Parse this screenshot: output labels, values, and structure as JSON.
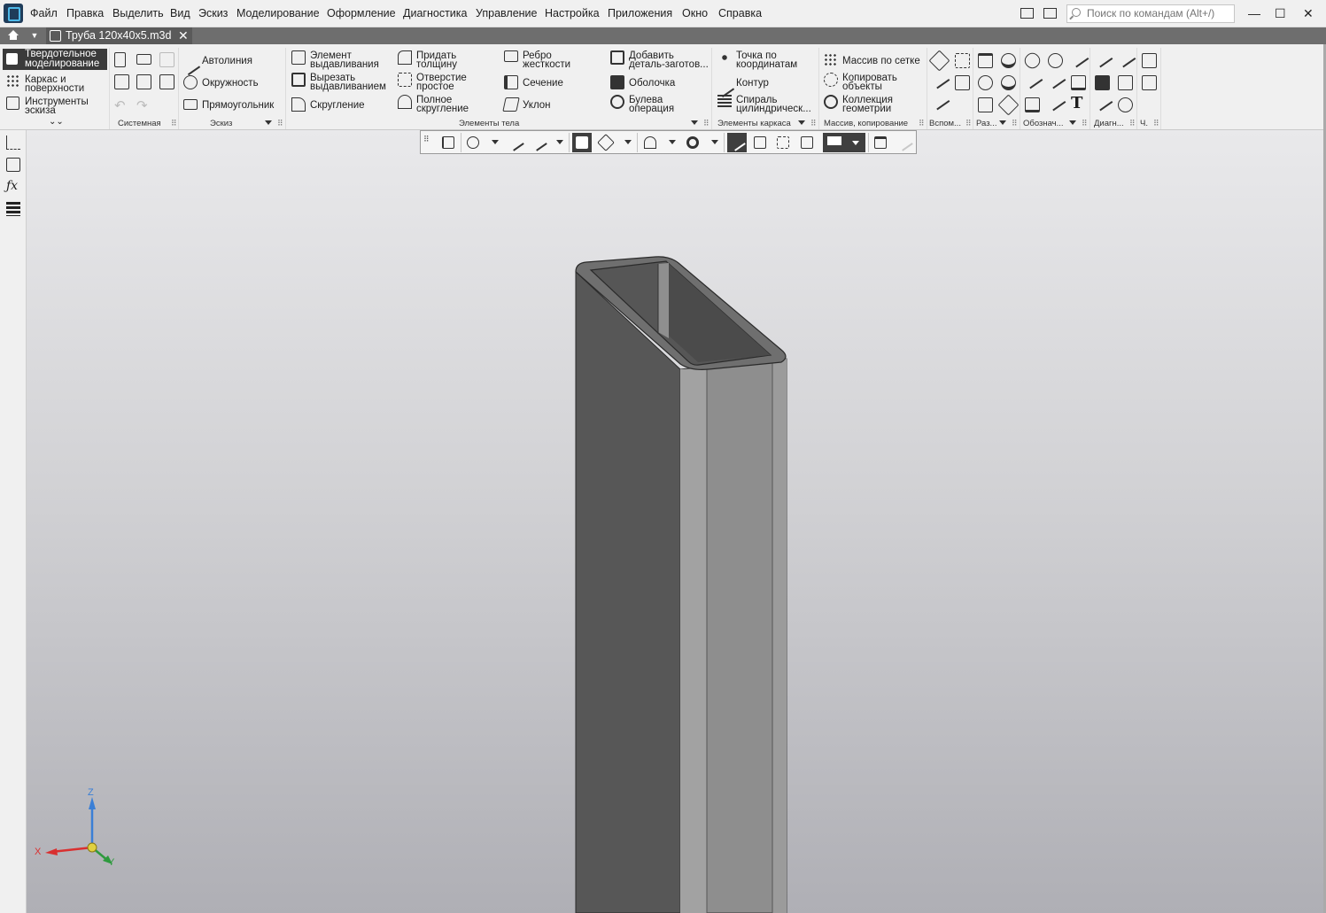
{
  "menu": {
    "items": [
      "Файл",
      "Правка",
      "Выделить",
      "Вид",
      "Эскиз",
      "Моделирование",
      "Оформление",
      "Диагностика",
      "Управление",
      "Настройка",
      "Приложения",
      "Окно",
      "Справка"
    ],
    "search_placeholder": "Поиск по командам (Alt+/)"
  },
  "window_controls": {
    "minimize": "—",
    "maximize": "☐",
    "close": "✕"
  },
  "tab": {
    "title": "Труба 120x40x5.m3d",
    "close": "✕"
  },
  "ribbon": {
    "modes": {
      "solid": [
        "Твердотельное",
        "моделирование"
      ],
      "wireframe": [
        "Каркас и",
        "поверхности"
      ],
      "sketch_tools": [
        "Инструменты",
        "эскиза"
      ]
    },
    "sketch": {
      "autoline": "Автолиния",
      "circle": "Окружность",
      "rectangle": "Прямоугольник"
    },
    "body": {
      "extrude": [
        "Элемент",
        "выдавливания"
      ],
      "cut_extrude": [
        "Вырезать",
        "выдавливанием"
      ],
      "fillet": "Скругление",
      "thicken": [
        "Придать",
        "толщину"
      ],
      "hole": [
        "Отверстие",
        "простое"
      ],
      "full_round": [
        "Полное",
        "скругление"
      ],
      "rib": [
        "Ребро",
        "жесткости"
      ],
      "section": "Сечение",
      "draft": "Уклон",
      "add_stock": [
        "Добавить",
        "деталь-заготов..."
      ],
      "shell": "Оболочка",
      "boolean": [
        "Булева",
        "операция"
      ]
    },
    "frame": {
      "point": [
        "Точка по",
        "координатам"
      ],
      "contour": "Контур",
      "helix": [
        "Спираль",
        "цилиндрическ..."
      ]
    },
    "array": {
      "grid": "Массив по сетке",
      "copy": [
        "Копировать",
        "объекты"
      ],
      "collection": [
        "Коллекция",
        "геометрии"
      ]
    },
    "groups": {
      "system": "Системная",
      "sketch": "Эскиз",
      "body": "Элементы тела",
      "frame": "Элементы каркаса",
      "array": "Массив, копирование",
      "aux": "Вспом...",
      "sizes": "Раз...",
      "notation": "Обознач...",
      "diag": "Диагн...",
      "other": "Ч."
    }
  },
  "triad": {
    "x": "X",
    "y": "Y",
    "z": "Z"
  },
  "colors": {
    "accent": "#3a3a3a",
    "tab_bar": "#6e6e6e",
    "axis_x": "#d93030",
    "axis_y": "#2e9a3e",
    "axis_z": "#3a7fd6"
  }
}
